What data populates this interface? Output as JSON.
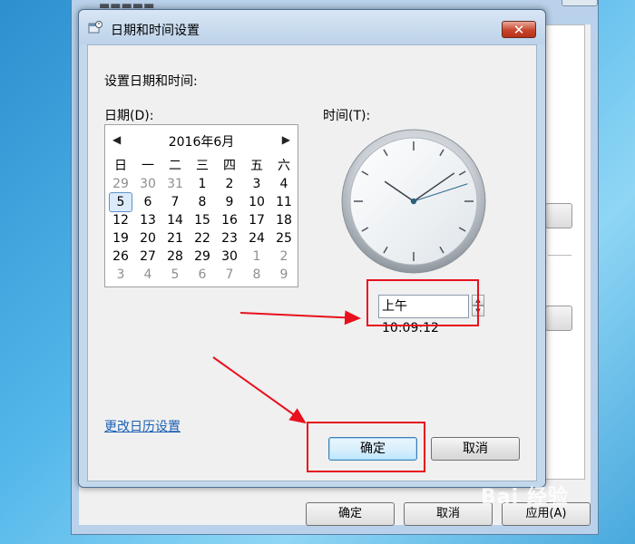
{
  "background_window": {
    "buttons": [
      "确定",
      "取消",
      "应用(A)"
    ]
  },
  "dialog": {
    "title": "日期和时间设置",
    "close_glyph": "✕",
    "heading": "设置日期和时间:",
    "date_label": "日期(D):",
    "time_label": "时间(T):",
    "calendar": {
      "prev_glyph": "◀",
      "next_glyph": "▶",
      "month_title": "2016年6月",
      "weekdays": [
        "日",
        "一",
        "二",
        "三",
        "四",
        "五",
        "六"
      ],
      "selected_day": "5",
      "weeks": [
        [
          {
            "d": "29",
            "dim": true
          },
          {
            "d": "30",
            "dim": true
          },
          {
            "d": "31",
            "dim": true
          },
          {
            "d": "1"
          },
          {
            "d": "2"
          },
          {
            "d": "3"
          },
          {
            "d": "4"
          }
        ],
        [
          {
            "d": "5",
            "sel": true
          },
          {
            "d": "6"
          },
          {
            "d": "7"
          },
          {
            "d": "8"
          },
          {
            "d": "9"
          },
          {
            "d": "10"
          },
          {
            "d": "11"
          }
        ],
        [
          {
            "d": "12"
          },
          {
            "d": "13"
          },
          {
            "d": "14"
          },
          {
            "d": "15"
          },
          {
            "d": "16"
          },
          {
            "d": "17"
          },
          {
            "d": "18"
          }
        ],
        [
          {
            "d": "19"
          },
          {
            "d": "20"
          },
          {
            "d": "21"
          },
          {
            "d": "22"
          },
          {
            "d": "23"
          },
          {
            "d": "24"
          },
          {
            "d": "25"
          }
        ],
        [
          {
            "d": "26"
          },
          {
            "d": "27"
          },
          {
            "d": "28"
          },
          {
            "d": "29"
          },
          {
            "d": "30"
          },
          {
            "d": "1",
            "dim": true
          },
          {
            "d": "2",
            "dim": true
          }
        ],
        [
          {
            "d": "3",
            "dim": true
          },
          {
            "d": "4",
            "dim": true
          },
          {
            "d": "5",
            "dim": true
          },
          {
            "d": "6",
            "dim": true
          },
          {
            "d": "7",
            "dim": true
          },
          {
            "d": "8",
            "dim": true
          },
          {
            "d": "9",
            "dim": true
          }
        ]
      ]
    },
    "clock": {
      "hour": 10,
      "minute": 9,
      "second": 12
    },
    "time_value": "上午 10:09:12",
    "change_calendar_link": "更改日历设置",
    "ok_label": "确定",
    "cancel_label": "取消"
  },
  "annotation_color": "#e8101c",
  "watermark": "Bai 经验"
}
